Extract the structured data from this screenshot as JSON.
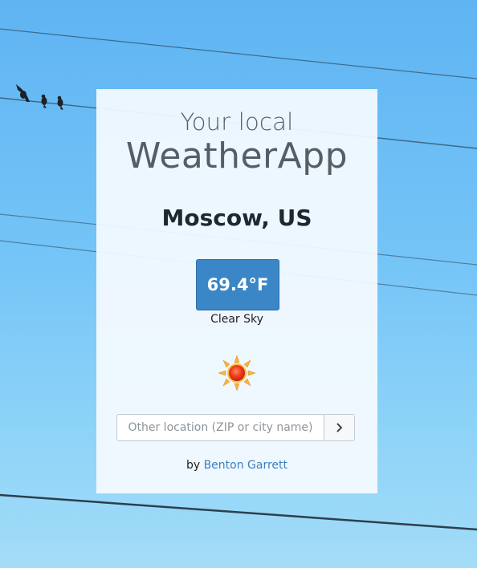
{
  "header": {
    "subtitle": "Your local",
    "app_name": "WeatherApp"
  },
  "weather": {
    "location": "Moscow, US",
    "temperature": "69.4°F",
    "condition": "Clear Sky",
    "icon": "sun-icon"
  },
  "search": {
    "placeholder": "Other location (ZIP or city name)",
    "value": "",
    "button_icon": "chevron-right-icon"
  },
  "footer": {
    "by_label": "by",
    "author": "Benton Garrett"
  },
  "colors": {
    "sky": "#74c4f7",
    "temp_box": "#3b86c6",
    "link": "#3b7ec0",
    "card": "#f6fbff"
  }
}
